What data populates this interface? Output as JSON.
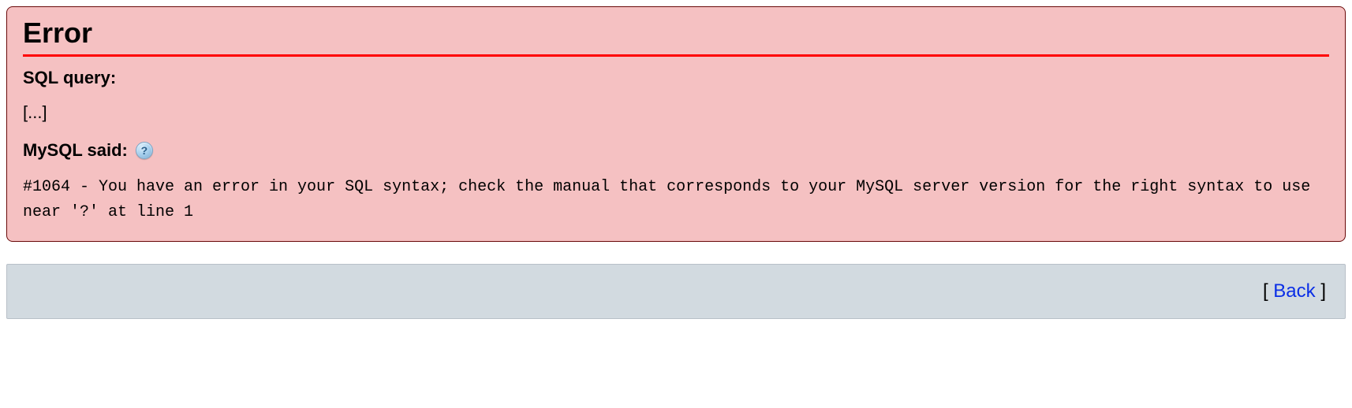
{
  "error": {
    "title": "Error",
    "sql_query_label": "SQL query:",
    "sql_query_text": "[...]",
    "mysql_said_label": "MySQL said:",
    "help_icon_name": "help-icon",
    "message": "#1064 - You have an error in your SQL syntax; check the manual that corresponds to your MySQL server version for the right syntax to use near '?' at line 1"
  },
  "footer": {
    "back_label": "Back",
    "bracket_open": "[ ",
    "bracket_close": " ]"
  }
}
